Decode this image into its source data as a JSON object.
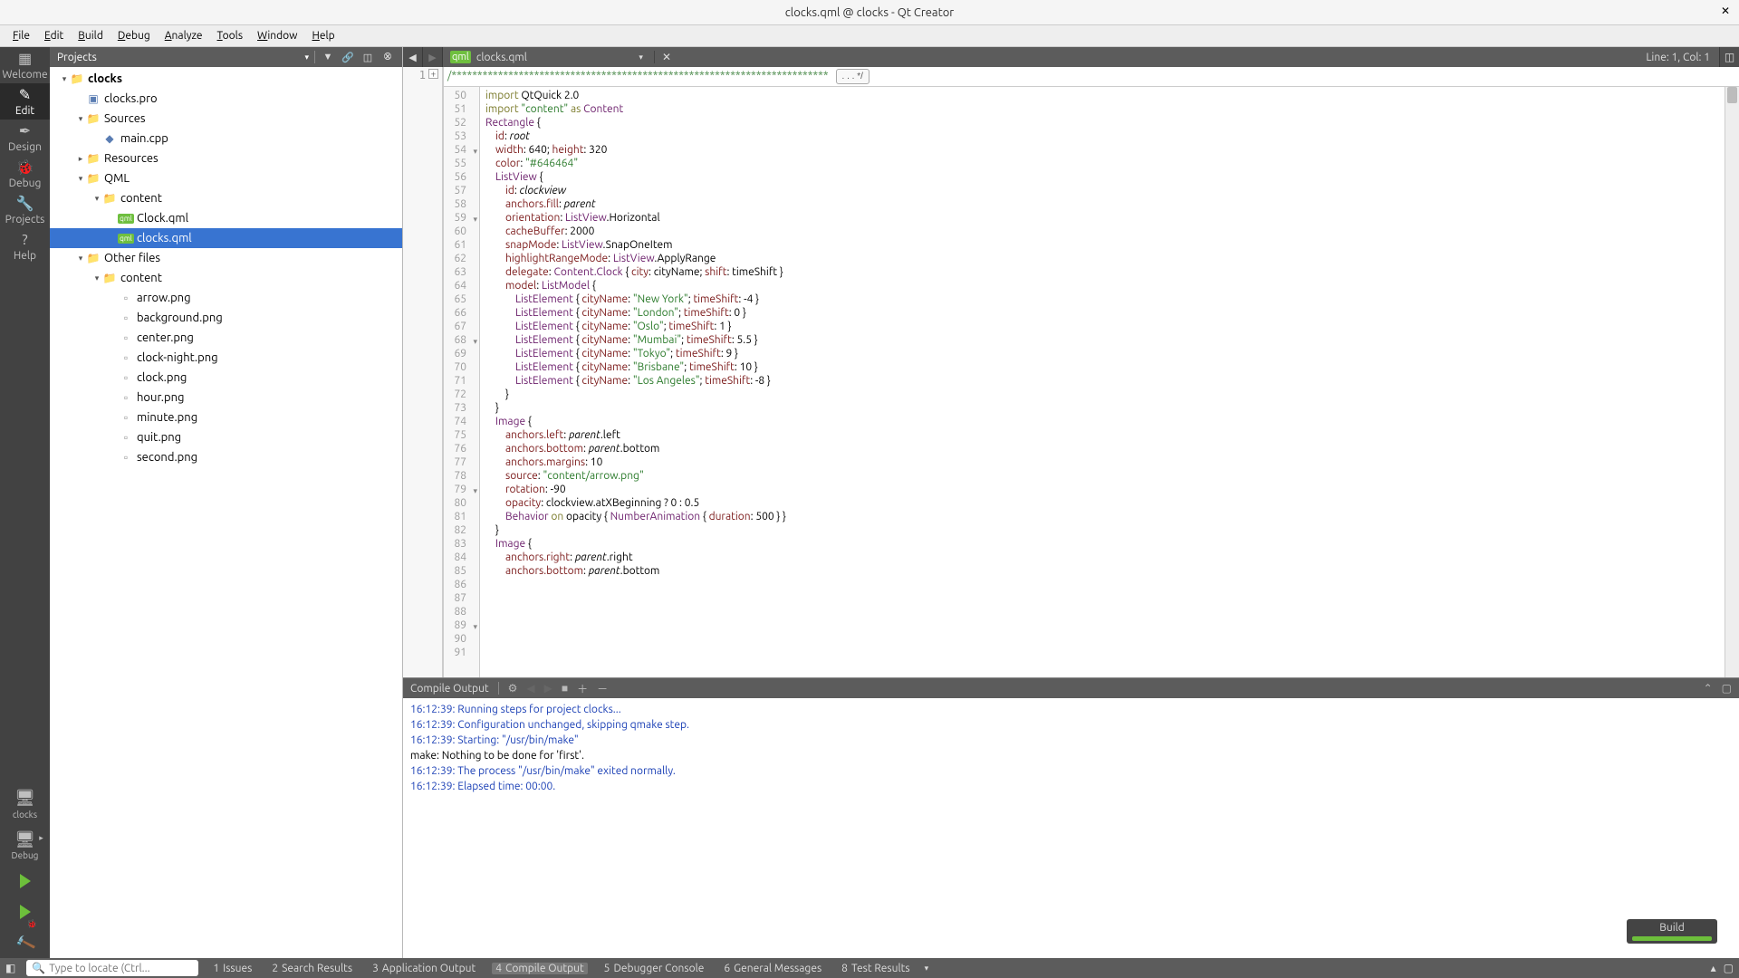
{
  "window": {
    "title": "clocks.qml @ clocks - Qt Creator"
  },
  "menu": [
    "File",
    "Edit",
    "Build",
    "Debug",
    "Analyze",
    "Tools",
    "Window",
    "Help"
  ],
  "menu_mnemonic_index": [
    0,
    0,
    0,
    0,
    0,
    0,
    0,
    0
  ],
  "modes": [
    {
      "label": "Welcome",
      "icon": "▦"
    },
    {
      "label": "Edit",
      "icon": "✎",
      "active": true
    },
    {
      "label": "Design",
      "icon": "✒"
    },
    {
      "label": "Debug",
      "icon": "🐞"
    },
    {
      "label": "Projects",
      "icon": "🔧"
    },
    {
      "label": "Help",
      "icon": "?"
    }
  ],
  "kit": {
    "name": "clocks",
    "config": "Debug"
  },
  "projects_pane_title": "Projects",
  "tree": [
    {
      "depth": 0,
      "arrow": "▾",
      "icon": "folder",
      "label": "clocks",
      "bold": true
    },
    {
      "depth": 1,
      "arrow": "",
      "icon": "pro",
      "label": "clocks.pro"
    },
    {
      "depth": 1,
      "arrow": "▾",
      "icon": "folder",
      "label": "Sources"
    },
    {
      "depth": 2,
      "arrow": "",
      "icon": "cpp",
      "label": "main.cpp"
    },
    {
      "depth": 1,
      "arrow": "▸",
      "icon": "folder",
      "label": "Resources"
    },
    {
      "depth": 1,
      "arrow": "▾",
      "icon": "folder",
      "label": "QML"
    },
    {
      "depth": 2,
      "arrow": "▾",
      "icon": "folder",
      "label": "content"
    },
    {
      "depth": 3,
      "arrow": "",
      "icon": "qml",
      "label": "Clock.qml"
    },
    {
      "depth": 3,
      "arrow": "",
      "icon": "qml",
      "label": "clocks.qml",
      "selected": true
    },
    {
      "depth": 1,
      "arrow": "▾",
      "icon": "folder",
      "label": "Other files"
    },
    {
      "depth": 2,
      "arrow": "▾",
      "icon": "folder",
      "label": "content"
    },
    {
      "depth": 3,
      "arrow": "",
      "icon": "png",
      "label": "arrow.png"
    },
    {
      "depth": 3,
      "arrow": "",
      "icon": "png",
      "label": "background.png"
    },
    {
      "depth": 3,
      "arrow": "",
      "icon": "png",
      "label": "center.png"
    },
    {
      "depth": 3,
      "arrow": "",
      "icon": "png",
      "label": "clock-night.png"
    },
    {
      "depth": 3,
      "arrow": "",
      "icon": "png",
      "label": "clock.png"
    },
    {
      "depth": 3,
      "arrow": "",
      "icon": "png",
      "label": "hour.png"
    },
    {
      "depth": 3,
      "arrow": "",
      "icon": "png",
      "label": "minute.png"
    },
    {
      "depth": 3,
      "arrow": "",
      "icon": "png",
      "label": "quit.png"
    },
    {
      "depth": 3,
      "arrow": "",
      "icon": "png",
      "label": "second.png"
    }
  ],
  "editor": {
    "tab_file": "clocks.qml",
    "linecol": "Line: 1, Col: 1",
    "left_first_line_comment": "/*************************************************************************",
    "fold_badge": ". . . */"
  },
  "code_lines": [
    {
      "n": 50,
      "h": ""
    },
    {
      "n": 51,
      "h": "<span class='kw'>import</span> QtQuick 2.0"
    },
    {
      "n": 52,
      "h": "<span class='kw'>import</span> <span class='str'>\"content\"</span> <span class='kw'>as</span> <span class='type'>Content</span>"
    },
    {
      "n": 53,
      "h": ""
    },
    {
      "n": 54,
      "h": "<span class='type'>Rectangle</span> {",
      "fold": true
    },
    {
      "n": 55,
      "h": "    <span class='prop'>id</span>: <span class='ital'>root</span>"
    },
    {
      "n": 56,
      "h": "    <span class='prop'>width</span>: 640; <span class='prop'>height</span>: 320"
    },
    {
      "n": 57,
      "h": "    <span class='prop'>color</span>: <span class='str'>\"#646464\"</span>"
    },
    {
      "n": 58,
      "h": ""
    },
    {
      "n": 59,
      "h": "    <span class='type'>ListView</span> {",
      "fold": true
    },
    {
      "n": 60,
      "h": "        <span class='prop'>id</span>: <span class='ital'>clockview</span>"
    },
    {
      "n": 61,
      "h": "        <span class='prop'>anchors.fill</span>: <span class='ital'>parent</span>"
    },
    {
      "n": 62,
      "h": "        <span class='prop'>orientation</span>: <span class='type'>ListView</span>.Horizontal"
    },
    {
      "n": 63,
      "h": "        <span class='prop'>cacheBuffer</span>: 2000"
    },
    {
      "n": 64,
      "h": "        <span class='prop'>snapMode</span>: <span class='type'>ListView</span>.SnapOneItem"
    },
    {
      "n": 65,
      "h": "        <span class='prop'>highlightRangeMode</span>: <span class='type'>ListView</span>.ApplyRange"
    },
    {
      "n": 66,
      "h": ""
    },
    {
      "n": 67,
      "h": "        <span class='prop'>delegate</span>: <span class='type'>Content.Clock</span> { <span class='prop'>city</span>: cityName; <span class='prop'>shift</span>: timeShift }"
    },
    {
      "n": 68,
      "h": "        <span class='prop'>model</span>: <span class='type'>ListModel</span> {",
      "fold": true
    },
    {
      "n": 69,
      "h": "            <span class='type'>ListElement</span> { <span class='prop'>cityName</span>: <span class='str'>\"New York\"</span>; <span class='prop'>timeShift</span>: -4 }"
    },
    {
      "n": 70,
      "h": "            <span class='type'>ListElement</span> { <span class='prop'>cityName</span>: <span class='str'>\"London\"</span>; <span class='prop'>timeShift</span>: 0 }"
    },
    {
      "n": 71,
      "h": "            <span class='type'>ListElement</span> { <span class='prop'>cityName</span>: <span class='str'>\"Oslo\"</span>; <span class='prop'>timeShift</span>: 1 }"
    },
    {
      "n": 72,
      "h": "            <span class='type'>ListElement</span> { <span class='prop'>cityName</span>: <span class='str'>\"Mumbai\"</span>; <span class='prop'>timeShift</span>: 5.5 }"
    },
    {
      "n": 73,
      "h": "            <span class='type'>ListElement</span> { <span class='prop'>cityName</span>: <span class='str'>\"Tokyo\"</span>; <span class='prop'>timeShift</span>: 9 }"
    },
    {
      "n": 74,
      "h": "            <span class='type'>ListElement</span> { <span class='prop'>cityName</span>: <span class='str'>\"Brisbane\"</span>; <span class='prop'>timeShift</span>: 10 }"
    },
    {
      "n": 75,
      "h": "            <span class='type'>ListElement</span> { <span class='prop'>cityName</span>: <span class='str'>\"Los Angeles\"</span>; <span class='prop'>timeShift</span>: -8 }"
    },
    {
      "n": 76,
      "h": "        }"
    },
    {
      "n": 77,
      "h": "    }"
    },
    {
      "n": 78,
      "h": ""
    },
    {
      "n": 79,
      "h": "    <span class='type'>Image</span> {",
      "fold": true
    },
    {
      "n": 80,
      "h": "        <span class='prop'>anchors.left</span>: <span class='ital'>parent</span>.left"
    },
    {
      "n": 81,
      "h": "        <span class='prop'>anchors.bottom</span>: <span class='ital'>parent</span>.bottom"
    },
    {
      "n": 82,
      "h": "        <span class='prop'>anchors.margins</span>: 10"
    },
    {
      "n": 83,
      "h": "        <span class='prop'>source</span>: <span class='str'>\"content/arrow.png\"</span>"
    },
    {
      "n": 84,
      "h": "        <span class='prop'>rotation</span>: -90"
    },
    {
      "n": 85,
      "h": "        <span class='prop'>opacity</span>: clockview.atXBeginning ? 0 : 0.5"
    },
    {
      "n": 86,
      "h": "        <span class='type'>Behavior</span> <span class='kw'>on</span> opacity { <span class='type'>NumberAnimation</span> { <span class='prop'>duration</span>: 500 } }"
    },
    {
      "n": 87,
      "h": "    }"
    },
    {
      "n": 88,
      "h": ""
    },
    {
      "n": 89,
      "h": "    <span class='type'>Image</span> {",
      "fold": true
    },
    {
      "n": 90,
      "h": "        <span class='prop'>anchors.right</span>: <span class='ital'>parent</span>.right"
    },
    {
      "n": 91,
      "h": "        <span class='prop'>anchors.bottom</span>: <span class='ital'>parent</span>.bottom"
    }
  ],
  "compile": {
    "title": "Compile Output",
    "lines": [
      {
        "ts": "16:12:39:",
        "msg": "Running steps for project clocks..."
      },
      {
        "ts": "16:12:39:",
        "msg": "Configuration unchanged, skipping qmake step."
      },
      {
        "ts": "16:12:39:",
        "msg": "Starting: \"/usr/bin/make\""
      },
      {
        "ts": "",
        "msg": "make: Nothing to be done for 'first'."
      },
      {
        "ts": "16:12:39:",
        "msg": "The process \"/usr/bin/make\" exited normally."
      },
      {
        "ts": "16:12:39:",
        "msg": "Elapsed time: 00:00."
      }
    ]
  },
  "bottom": {
    "locator_placeholder": "Type to locate (Ctrl...",
    "panes": [
      {
        "n": "1",
        "label": "Issues"
      },
      {
        "n": "2",
        "label": "Search Results"
      },
      {
        "n": "3",
        "label": "Application Output"
      },
      {
        "n": "4",
        "label": "Compile Output",
        "active": true
      },
      {
        "n": "5",
        "label": "Debugger Console"
      },
      {
        "n": "6",
        "label": "General Messages"
      },
      {
        "n": "8",
        "label": "Test Results"
      }
    ]
  },
  "build_toast": {
    "label": "Build"
  }
}
